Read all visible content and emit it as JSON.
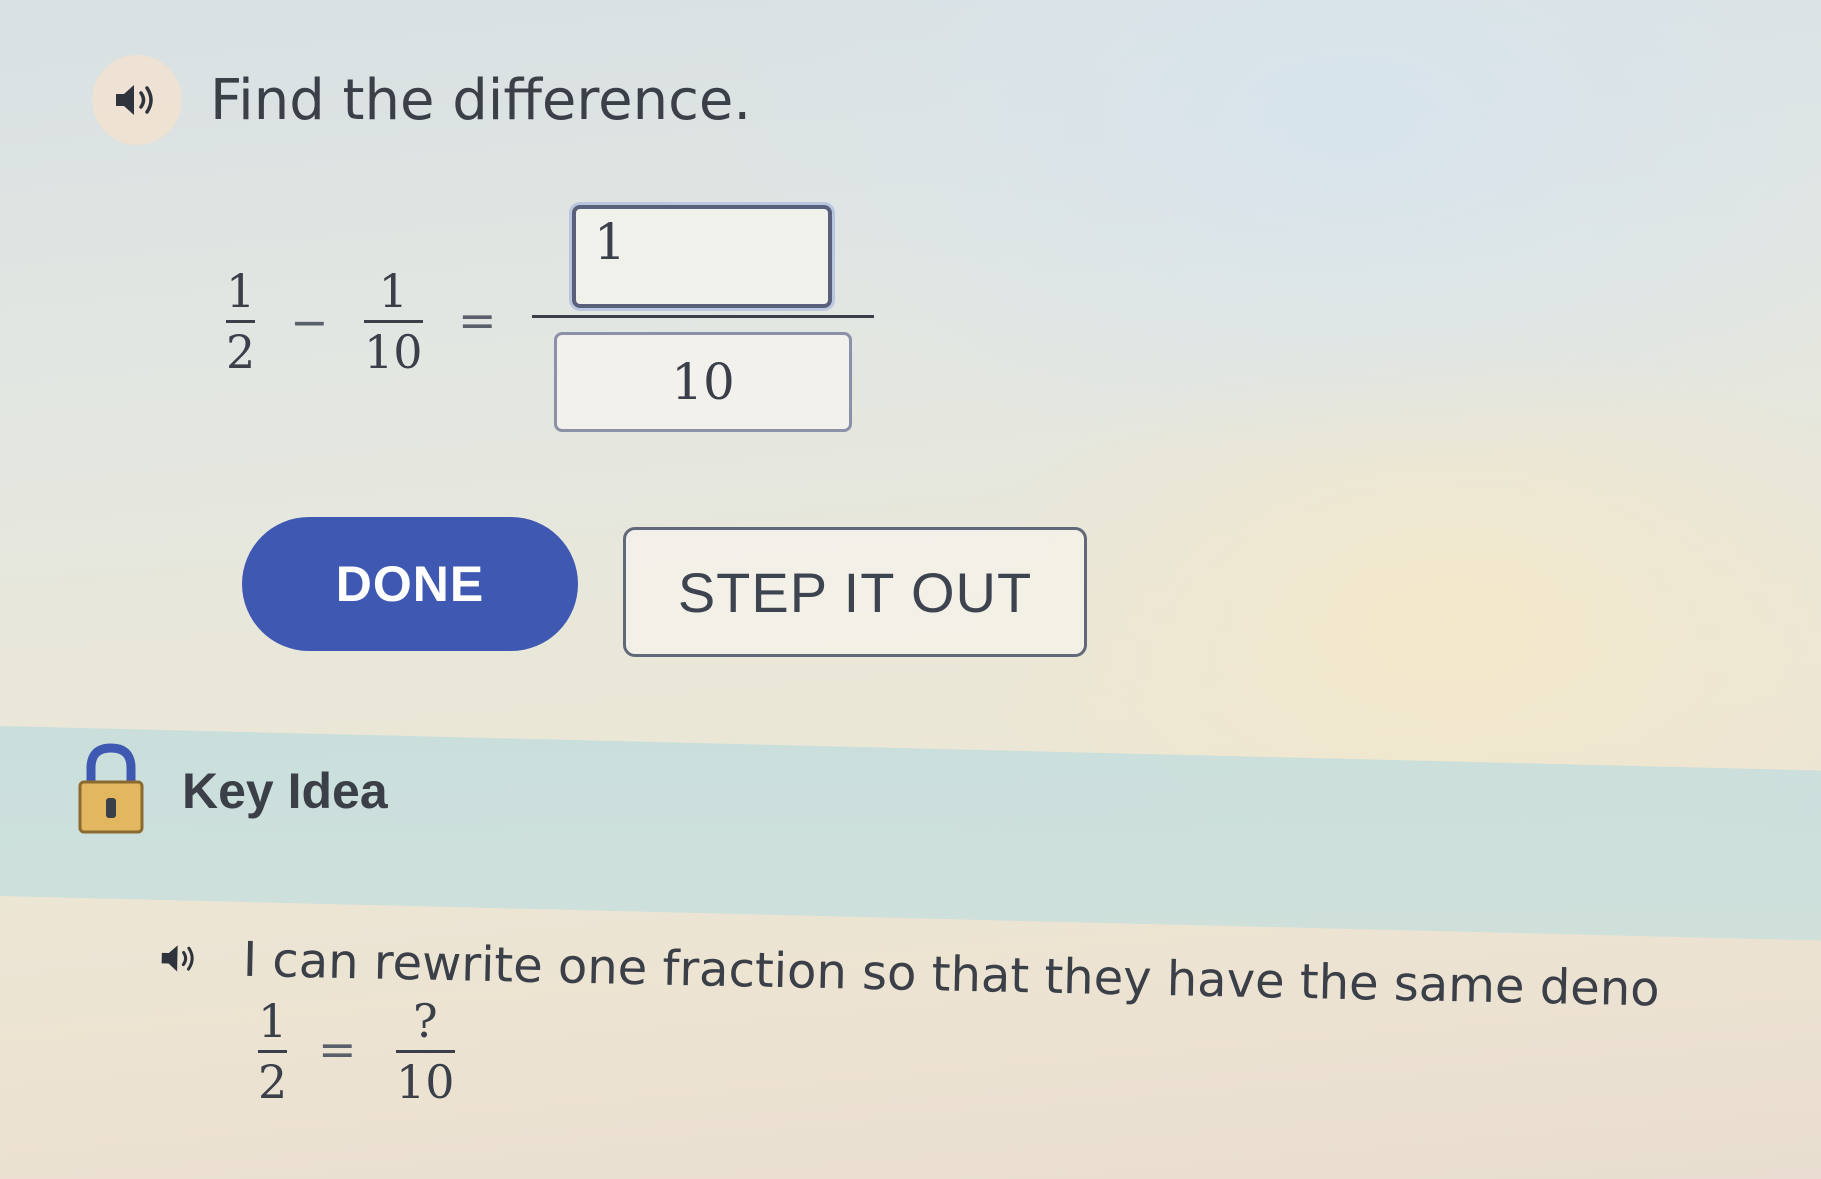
{
  "prompt": {
    "text": "Find the difference."
  },
  "equation": {
    "left": {
      "numerator": "1",
      "denominator": "2"
    },
    "operator": "−",
    "right": {
      "numerator": "1",
      "denominator": "10"
    },
    "equals": "=",
    "answer": {
      "numerator_value": "1",
      "denominator_value": "10"
    }
  },
  "buttons": {
    "done_label": "DONE",
    "step_label": "STEP IT OUT"
  },
  "key_idea": {
    "title": "Key Idea",
    "hint_text": "I can rewrite one fraction so that they have the same deno",
    "hint_fraction": {
      "left": {
        "numerator": "1",
        "denominator": "2"
      },
      "equals": "=",
      "right": {
        "numerator": "?",
        "denominator": "10"
      }
    }
  },
  "colors": {
    "done_button": "#3f59b3",
    "text": "#3b3f48",
    "key_band": "#c8dedc",
    "lock_body": "#e2b75f"
  },
  "icons": {
    "prompt_audio": "speaker-icon",
    "hint_audio": "speaker-icon",
    "key_idea": "lock-icon"
  }
}
